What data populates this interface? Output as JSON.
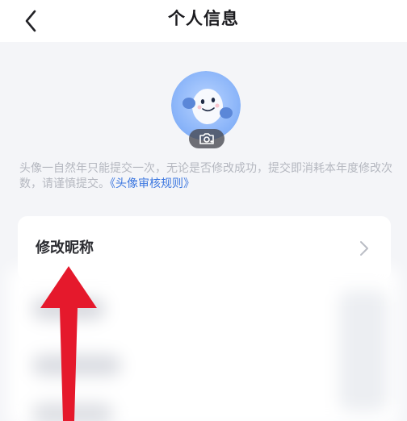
{
  "header": {
    "title": "个人信息",
    "back_icon": "chevron-left-icon"
  },
  "avatar": {
    "camera_icon": "camera-icon",
    "image": "cartoon-mascot-avatar"
  },
  "notice": {
    "text": "头像一自然年只能提交一次，无论是否修改成功，提交即消耗本年度修改次数，请谨慎提交。",
    "link": "《头像审核规则》"
  },
  "items": [
    {
      "label": "修改昵称",
      "icon": "chevron-right-icon"
    }
  ],
  "colors": {
    "background": "#f4f5f8",
    "card": "#ffffff",
    "link": "#3d78e0",
    "annotation_arrow": "#e5192c"
  }
}
